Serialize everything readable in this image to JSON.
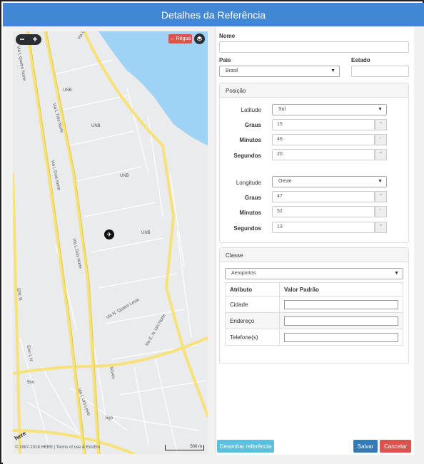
{
  "window": {
    "title": "Detalhes da Referência"
  },
  "map": {
    "ruler_label": "↔ Régua",
    "zoom_out": "−",
    "zoom_in": "+",
    "layers_icon": "layers-icon",
    "attribution": "© 1987-2018 HERE | Terms of use & Em/Em",
    "logo": "here",
    "scale": "500 m",
    "street_labels": [
      "Via L Quatro Norte",
      "Via L Três Norte",
      "Via L Dois Norte",
      "Via L Quatro Norte",
      "UNB",
      "Via N. Quatro Leste",
      "Via E. N. Um Norte",
      "Via L Um Leste",
      "ERL N",
      "Eixo L N",
      "Via L Dois Norte",
      "SGAN",
      "5bn",
      "5go"
    ]
  },
  "form": {
    "nome_label": "Nome",
    "nome_value": "",
    "pais_label": "País",
    "pais_value": "Brasil",
    "estado_label": "Estado",
    "estado_value": "",
    "posicao": {
      "title": "Posição",
      "latitude_label": "Latitude",
      "latitude_value": "Sul",
      "lat_graus_label": "Graus",
      "lat_graus_value": "15",
      "lat_graus_unit": "°",
      "lat_minutos_label": "Minutos",
      "lat_minutos_value": "46",
      "lat_minutos_unit": "'",
      "lat_segundos_label": "Segundos",
      "lat_segundos_value": "20",
      "lat_segundos_unit": "\"",
      "longitude_label": "Longitude",
      "longitude_value": "Oeste",
      "lon_graus_label": "Graus",
      "lon_graus_value": "47",
      "lon_graus_unit": "°",
      "lon_minutos_label": "Minutos",
      "lon_minutos_value": "52",
      "lon_minutos_unit": "'",
      "lon_segundos_label": "Segundos",
      "lon_segundos_value": "13",
      "lon_segundos_unit": "\""
    },
    "classe": {
      "title": "Classe",
      "selected": "Aeroportos",
      "columns": [
        "Atributo",
        "Valor Padrão"
      ],
      "rows": [
        {
          "attr": "Cidade",
          "value": ""
        },
        {
          "attr": "Endereço",
          "value": ""
        },
        {
          "attr": "Telefone(s)",
          "value": ""
        }
      ]
    }
  },
  "buttons": {
    "draw": "Desenhar referência",
    "save": "Salvar",
    "cancel": "Cancelar"
  },
  "colors": {
    "titlebar": "#4187d3",
    "draw_button": "#5bc0de",
    "save_button": "#337ab7",
    "cancel_button": "#d9534f",
    "water": "#9fd3f5",
    "road_major": "#f7e27a"
  }
}
